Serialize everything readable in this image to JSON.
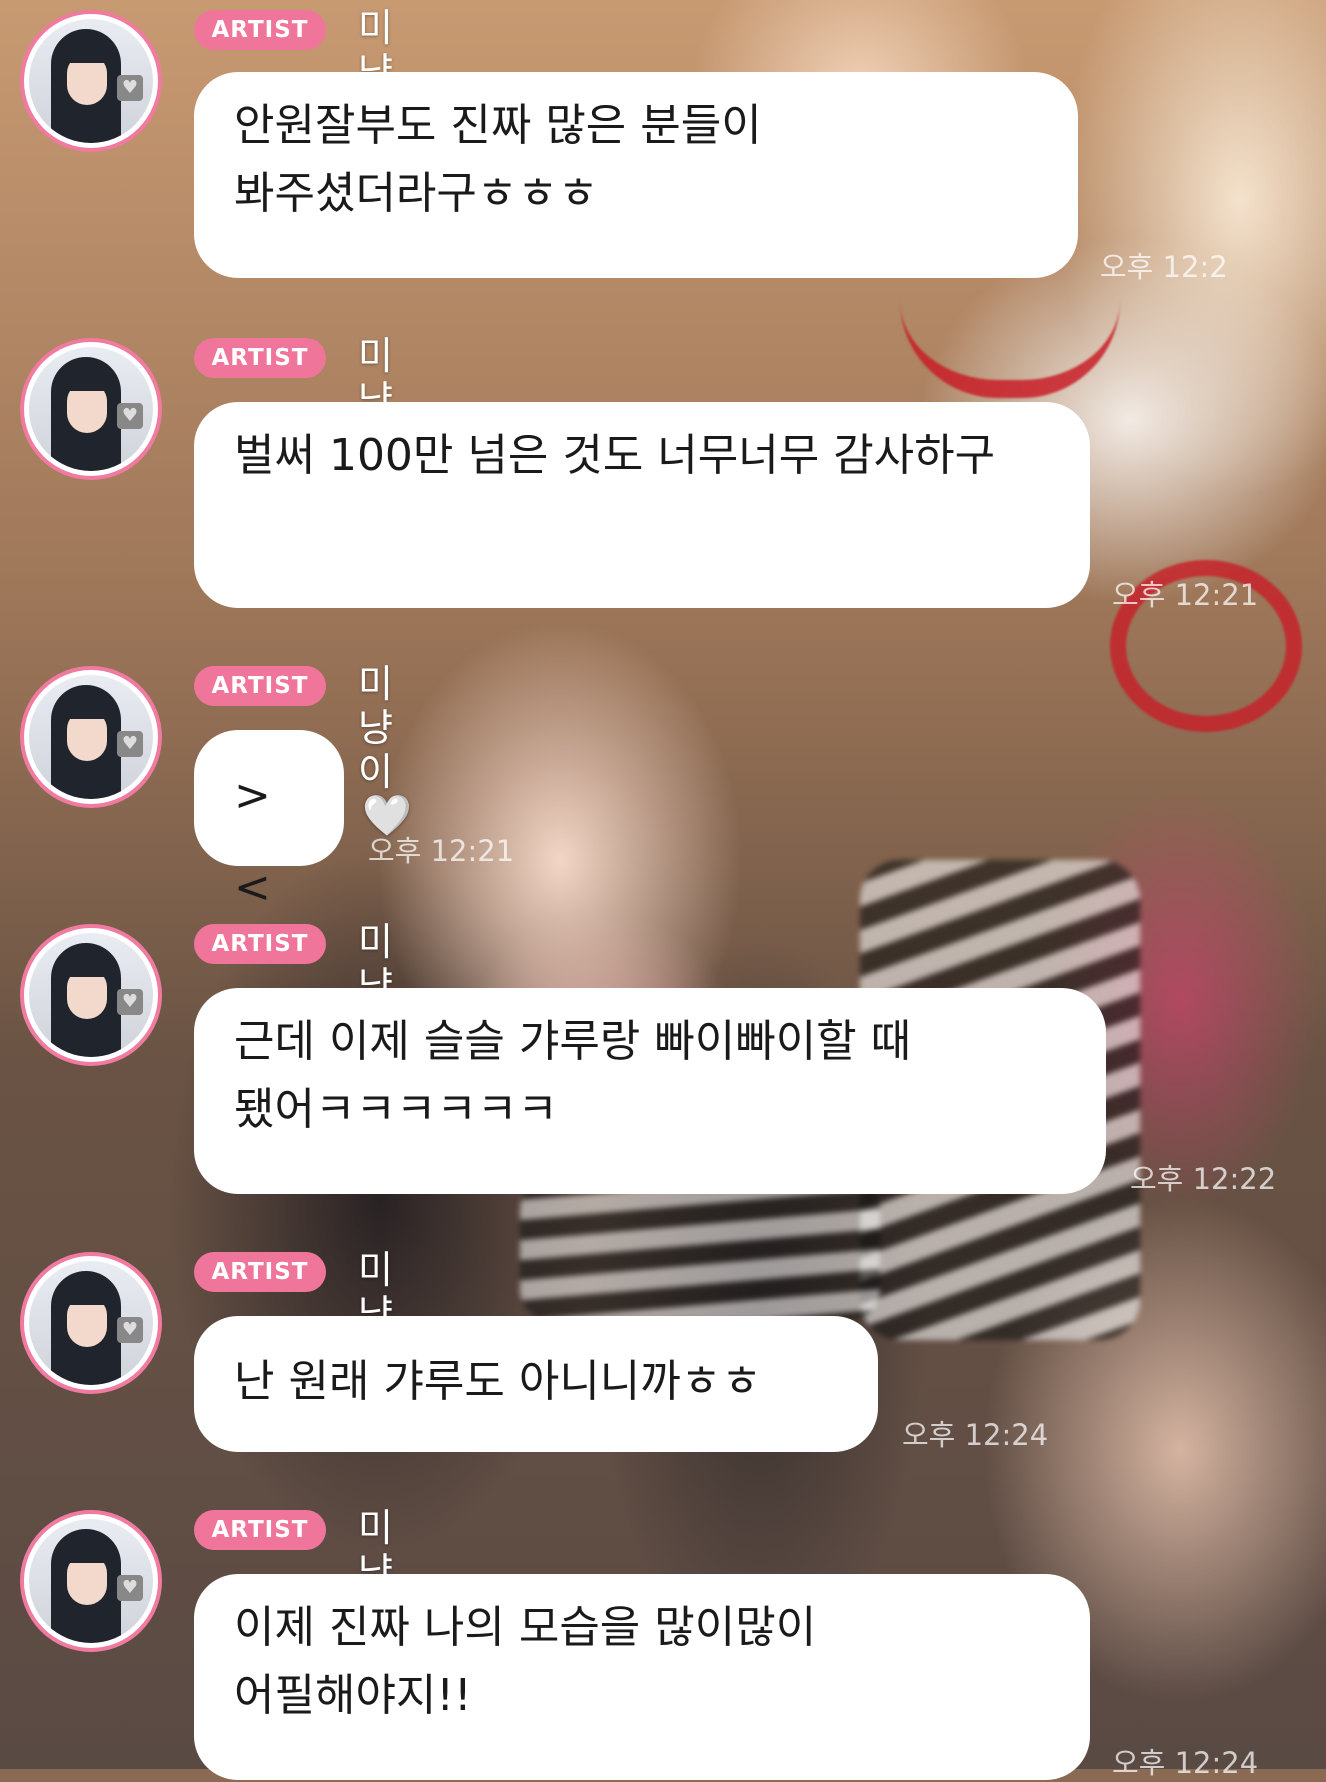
{
  "messages": [
    {
      "badge": "ARTIST",
      "username": "미냥이",
      "heart": "🤍",
      "text": "안원잘부도 진짜 많은 분들이 봐주셨더라구ㅎㅎㅎ",
      "time": "오후 12:2"
    },
    {
      "badge": "ARTIST",
      "username": "미냥이",
      "heart": "🤍",
      "text": "벌써 100만 넘은 것도 너무너무 감사하구",
      "time": "오후 12:21"
    },
    {
      "badge": "ARTIST",
      "username": "미냥이",
      "heart": "🤍",
      "text": "><",
      "time": "오후 12:21"
    },
    {
      "badge": "ARTIST",
      "username": "미냥이",
      "heart": "🤍",
      "text": "근데 이제 슬슬 갸루랑 빠이빠이할 때 됐어ㅋㅋㅋㅋㅋㅋ",
      "time": "오후 12:22"
    },
    {
      "badge": "ARTIST",
      "username": "미냥이",
      "heart": "🤍",
      "text": "난 원래 갸루도 아니니까ㅎㅎ",
      "time": "오후 12:24"
    },
    {
      "badge": "ARTIST",
      "username": "미냥이",
      "heart": "🤍",
      "text": "이제 진짜 나의 모습을 많이많이 어필해야지!!",
      "time": "오후 12:24"
    }
  ],
  "colors": {
    "badge": "#f0759b",
    "avatar_ring": "#f07aa0",
    "bubble": "#ffffff"
  }
}
